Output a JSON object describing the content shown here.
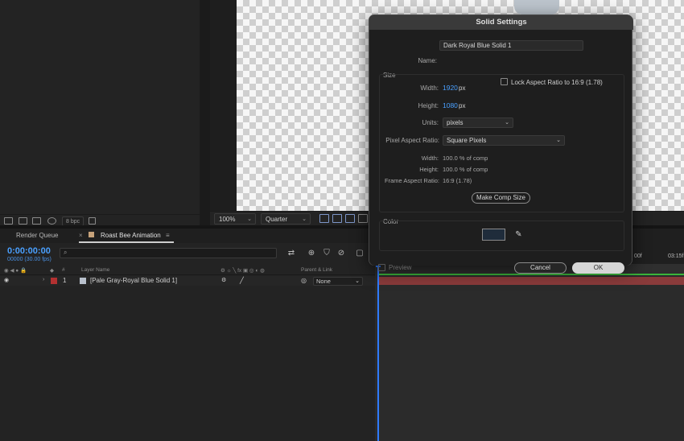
{
  "project_panel": {
    "bpc_label": "8 bpc"
  },
  "viewer": {
    "zoom": "100%",
    "resolution": "Quarter"
  },
  "timeline": {
    "tabs": [
      {
        "label": "Render Queue"
      },
      {
        "label": "Roast Bee Animation"
      }
    ],
    "time": "0:00:00:00",
    "frame": "00000 (30.00 fps)",
    "columns": {
      "number": "#",
      "layer_name": "Layer Name",
      "parent_link": "Parent & Link"
    },
    "layer": {
      "number": "1",
      "name": "[Pale Gray-Royal Blue Solid 1]",
      "parent": "None"
    },
    "ruler": [
      "00f",
      "03:15f"
    ]
  },
  "dialog": {
    "title": "Solid Settings",
    "name_label": "Name:",
    "name_value": "Dark Royal Blue Solid 1",
    "size_label": "Size",
    "width_label": "Width:",
    "width_value": "1920",
    "width_unit": "px",
    "height_label": "Height:",
    "height_value": "1080",
    "height_unit": "px",
    "lock_label": "Lock Aspect Ratio to 16:9 (1.78)",
    "units_label": "Units:",
    "units_value": "pixels",
    "par_label": "Pixel Aspect Ratio:",
    "par_value": "Square Pixels",
    "pct_width_label": "Width:",
    "pct_width_value": "100.0 % of comp",
    "pct_height_label": "Height:",
    "pct_height_value": "100.0 % of comp",
    "far_label": "Frame Aspect Ratio:",
    "far_value": "16:9 (1.78)",
    "make_comp": "Make Comp Size",
    "color_label": "Color",
    "color_hex": "#1f2c3b",
    "preview": "Preview",
    "cancel": "Cancel",
    "ok": "OK"
  }
}
